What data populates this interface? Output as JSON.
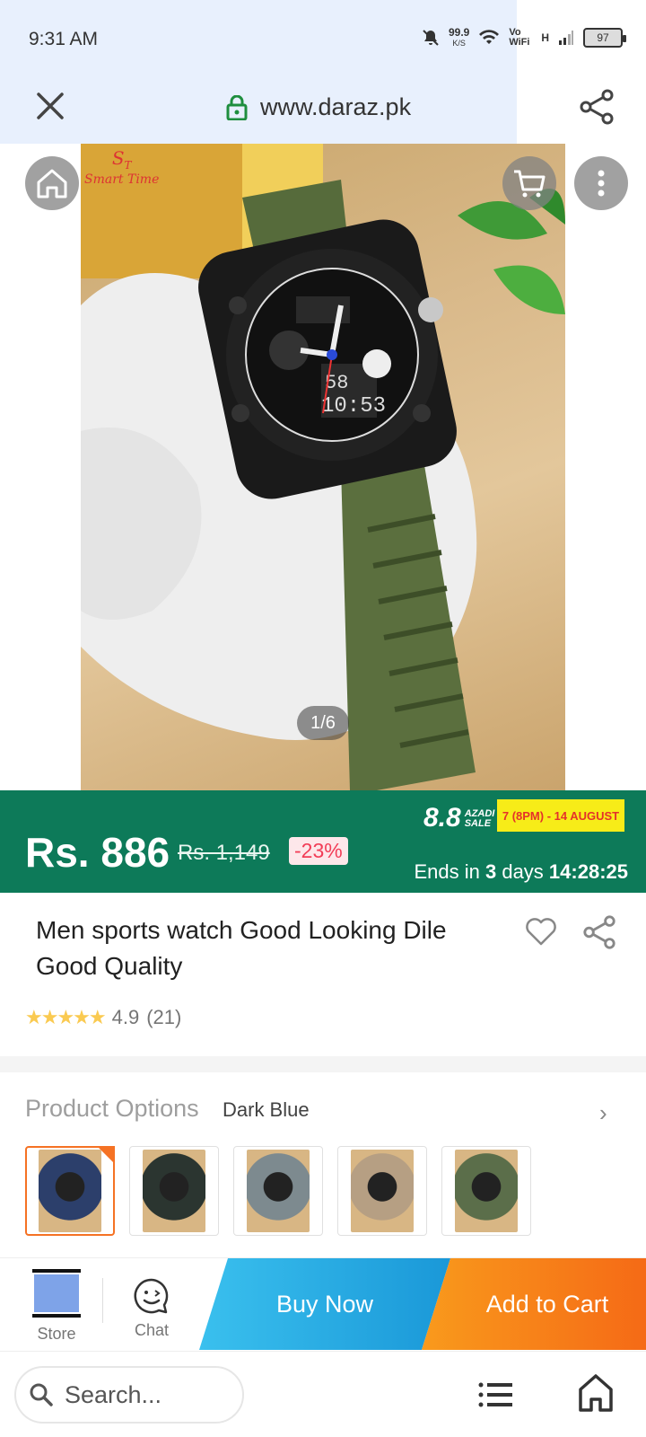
{
  "status_bar": {
    "time": "9:31 AM",
    "net_speed": "99.9",
    "net_unit": "K/S",
    "vowifi": "Vo WiFi",
    "signal_label": "H",
    "battery": "97"
  },
  "browser": {
    "url": "www.daraz.pk",
    "search_placeholder": "Search..."
  },
  "gallery": {
    "pager": "1/6"
  },
  "price": {
    "current": "Rs. 886",
    "original": "Rs. 1,149",
    "discount": "-23%",
    "sale_name": "8.8",
    "sale_tag": "AZADI SALE",
    "sale_dates": "7 (8PM) - 14 AUGUST",
    "ends_prefix": "Ends in ",
    "ends_days": "3",
    "ends_days_suffix": " days ",
    "ends_time": "14:28:25"
  },
  "product": {
    "title": "Men sports watch Good Looking Dile Good Quality",
    "rating": "4.9",
    "reviews": "(21)"
  },
  "options": {
    "label": "Product Options",
    "value": "Dark Blue",
    "thumb_colors": [
      "#2c3f6b",
      "#2b3530",
      "#7d8a8f",
      "#b69f83",
      "#5b6e4a"
    ]
  },
  "actions": {
    "store": "Store",
    "chat": "Chat",
    "buy_now": "Buy Now",
    "add_to_cart": "Add to Cart"
  },
  "colors": {
    "accent_green": "#0d7a59",
    "orange": "#f57224",
    "blue": "#1a98d8"
  }
}
